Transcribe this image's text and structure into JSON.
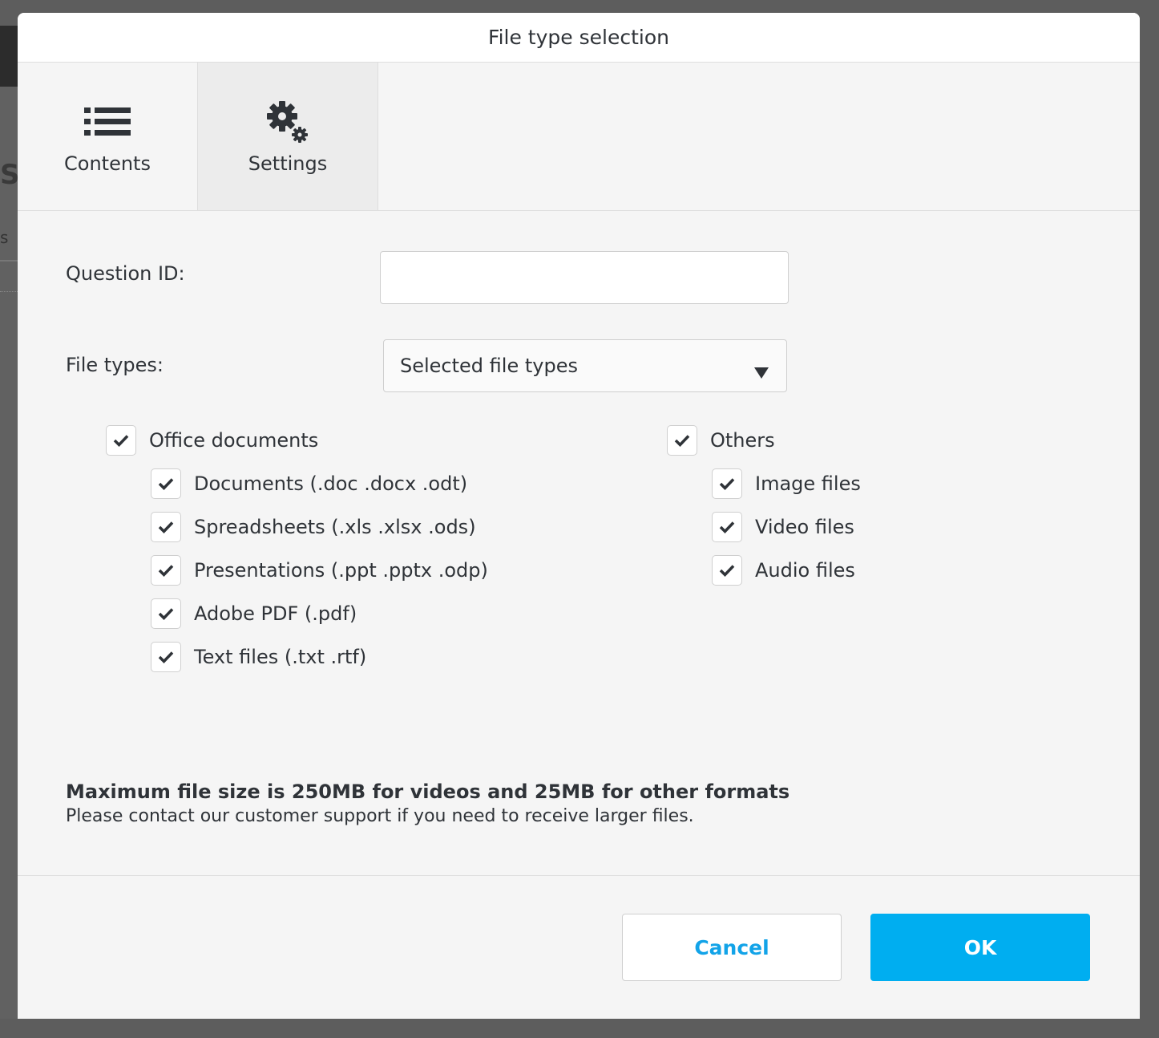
{
  "background": {
    "partial_heading": "S",
    "partial_text": "s"
  },
  "dialog": {
    "title": "File type selection"
  },
  "tabs": [
    {
      "label": "Contents",
      "icon": "list-icon",
      "active": false
    },
    {
      "label": "Settings",
      "icon": "gears-icon",
      "active": true
    }
  ],
  "settings": {
    "question_id": {
      "label": "Question ID:",
      "value": "",
      "placeholder": ""
    },
    "file_types": {
      "label": "File types:",
      "selected": "Selected file types"
    }
  },
  "groups": {
    "office": {
      "label": "Office documents",
      "checked": true,
      "items": [
        {
          "label": "Documents (.doc .docx .odt)",
          "checked": true
        },
        {
          "label": "Spreadsheets (.xls .xlsx .ods)",
          "checked": true
        },
        {
          "label": "Presentations (.ppt .pptx .odp)",
          "checked": true
        },
        {
          "label": "Adobe PDF (.pdf)",
          "checked": true
        },
        {
          "label": "Text files (.txt .rtf)",
          "checked": true
        }
      ]
    },
    "others": {
      "label": "Others",
      "checked": true,
      "items": [
        {
          "label": "Image files",
          "checked": true
        },
        {
          "label": "Video files",
          "checked": true
        },
        {
          "label": "Audio files",
          "checked": true
        }
      ]
    }
  },
  "note": {
    "bold": "Maximum file size is 250MB for videos and 25MB for other formats",
    "text": "Please contact our customer support if you need to receive larger files."
  },
  "buttons": {
    "cancel": "Cancel",
    "ok": "OK"
  },
  "colors": {
    "accent": "#00aef0",
    "cancel_text": "#12a3e8",
    "text": "#2f3338",
    "dialog_bg": "#f5f5f5"
  }
}
